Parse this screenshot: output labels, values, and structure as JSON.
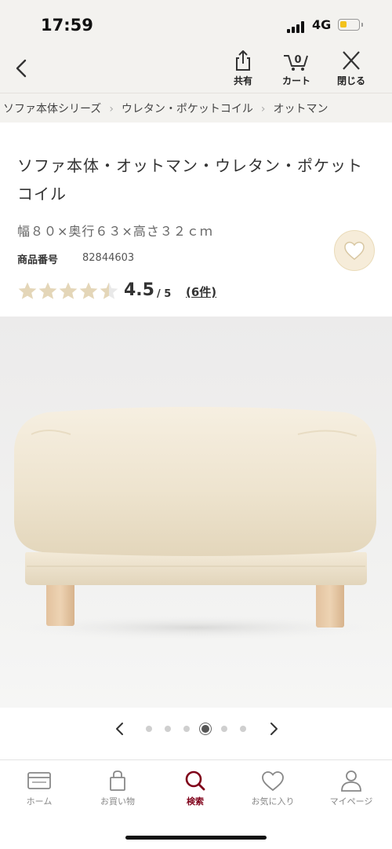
{
  "status_bar": {
    "time": "17:59",
    "network": "4G"
  },
  "nav": {
    "share_label": "共有",
    "cart_label": "カート",
    "cart_count": "0",
    "close_label": "閉じる"
  },
  "breadcrumb": [
    "ソファ本体シリーズ",
    "ウレタン・ポケットコイル",
    "オットマン"
  ],
  "product": {
    "title": "ソファ本体・オットマン・ウレタン・ポケットコイル",
    "size": "幅８０×奥行６３×高さ３２ｃｍ",
    "code_label": "商品番号",
    "code": "82844603",
    "rating": 4.5,
    "rating_text": "4.5",
    "rating_max": "/ 5",
    "reviews": "(6件)"
  },
  "carousel": {
    "total": 6,
    "active_index": 3
  },
  "tabs": [
    {
      "label": "ホーム",
      "icon": "card-icon"
    },
    {
      "label": "お買い物",
      "icon": "bag-icon"
    },
    {
      "label": "検索",
      "icon": "search-icon"
    },
    {
      "label": "お気に入り",
      "icon": "heart-icon"
    },
    {
      "label": "マイページ",
      "icon": "person-icon"
    }
  ],
  "colors": {
    "accent": "#7f0019",
    "star": "#e4d6b8",
    "header_bg": "#f3f2ef"
  }
}
